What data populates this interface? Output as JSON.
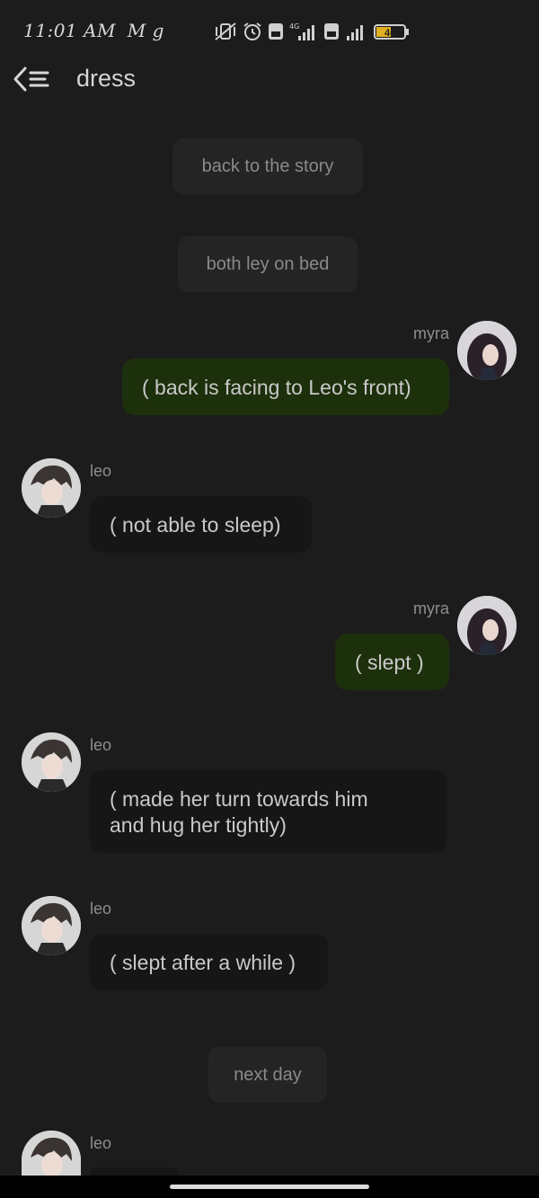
{
  "status_bar": {
    "time": "11:01 AM",
    "extra_left": "M  g",
    "battery": "46",
    "icons": [
      "mute-vibrate-icon",
      "alarm-icon",
      "volte-icon",
      "signal-4g-icon",
      "volte-icon",
      "signal-icon",
      "battery-icon"
    ]
  },
  "header": {
    "title": "dress"
  },
  "messages": [
    {
      "kind": "system",
      "text": "back to the story"
    },
    {
      "kind": "system",
      "text": "both ley on bed"
    },
    {
      "kind": "mine",
      "sender": "myra",
      "text": "( back is facing to Leo's front)"
    },
    {
      "kind": "theirs",
      "sender": "leo",
      "text": "( not able to sleep)"
    },
    {
      "kind": "mine",
      "sender": "myra",
      "text": "( slept )"
    },
    {
      "kind": "theirs",
      "sender": "leo",
      "text_line1": "( made her turn towards him",
      "text_line2": "and hug her tightly)"
    },
    {
      "kind": "theirs",
      "sender": "leo",
      "text": "( slept after a while )"
    },
    {
      "kind": "system",
      "text": "next day"
    },
    {
      "kind": "theirs",
      "sender": "leo",
      "text": ""
    }
  ],
  "colors": {
    "background": "#1c1c1c",
    "mine_bubble": "#1d300c",
    "theirs_bubble": "#161616",
    "system_pill": "#242424"
  }
}
